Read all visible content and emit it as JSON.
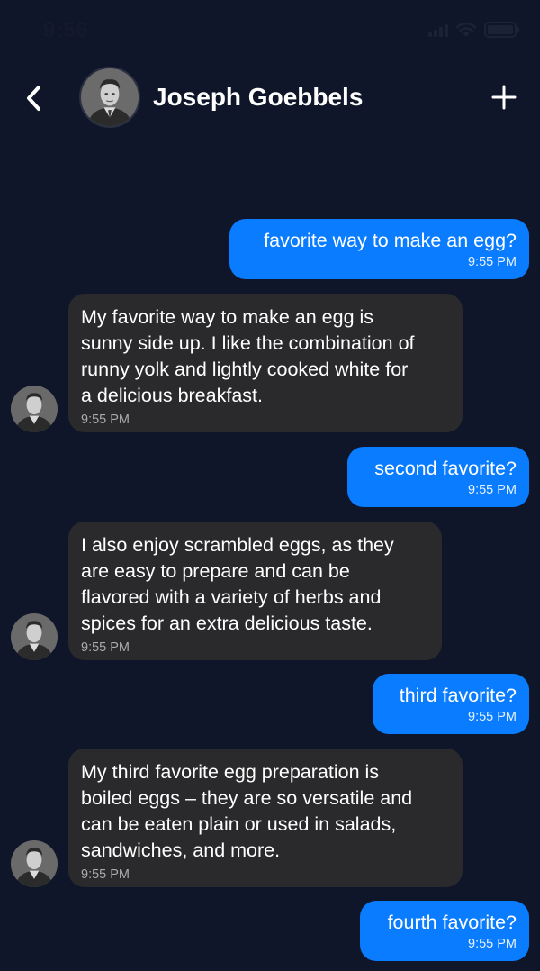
{
  "status_bar": {
    "time": "9:56"
  },
  "header": {
    "contact_name": "Joseph Goebbels"
  },
  "messages": [
    {
      "from": "me",
      "text": "favorite way to make an egg?",
      "time": "9:55 PM"
    },
    {
      "from": "contact",
      "text": "My favorite way to make an egg is\nsunny side up. I like the combination of\nrunny yolk and lightly cooked white for\na delicious breakfast.",
      "time": "9:55 PM"
    },
    {
      "from": "me",
      "text": "second favorite?",
      "time": "9:55 PM"
    },
    {
      "from": "contact",
      "text": "I also enjoy scrambled eggs, as they\nare easy to prepare and can be\nflavored with a variety of herbs and\nspices for an extra delicious taste.",
      "time": "9:55 PM"
    },
    {
      "from": "me",
      "text": "third favorite?",
      "time": "9:55 PM"
    },
    {
      "from": "contact",
      "text": "My third favorite egg preparation is\nboiled eggs – they are so versatile and\ncan be eaten plain or used in salads,\nsandwiches, and more.",
      "time": "9:55 PM"
    },
    {
      "from": "me",
      "text": "fourth favorite?",
      "time": "9:55 PM"
    }
  ],
  "icons": {
    "back": "chevron-left-icon",
    "add": "plus-icon",
    "wifi": "wifi-icon",
    "battery": "battery-icon",
    "signal": "signal-icon"
  },
  "colors": {
    "background": "#0f1629",
    "outgoing_bubble": "#0a7cff",
    "incoming_bubble": "#2a2a2c"
  }
}
